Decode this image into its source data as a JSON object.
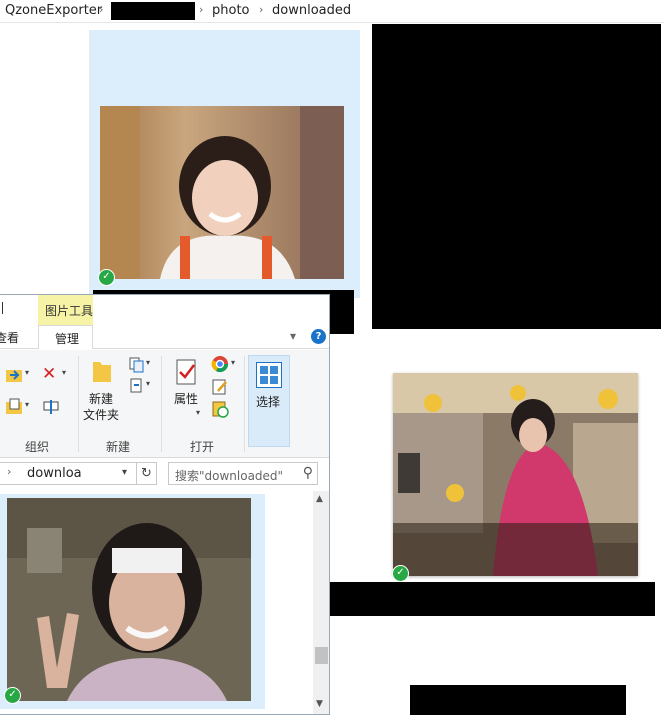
{
  "breadcrumb": {
    "root": "QzoneExporter",
    "folder": "photo",
    "current": "downloaded"
  },
  "front_window": {
    "tab_partial": "图片工具",
    "tab_view": "查看",
    "tab_manage": "管理",
    "ribbon": {
      "organize_label": "组织",
      "new_label": "新建",
      "new_folder_line1": "新建",
      "new_folder_line2": "文件夹",
      "open_label": "打开",
      "properties_label": "属性",
      "select_label": "选择"
    },
    "address_value": "downloa",
    "search_placeholder": "搜索\"downloaded\"",
    "help_glyph": "?"
  },
  "icons": {
    "check": "✓",
    "chevron": "›",
    "caret_down": "▾",
    "refresh": "↻",
    "search": "⚲",
    "close_x": "✕",
    "scroll_up": "▲",
    "scroll_down": "▼"
  },
  "colors": {
    "selection": "#dceefb",
    "tools_tab": "#f7f3a6",
    "check": "#28a745"
  }
}
